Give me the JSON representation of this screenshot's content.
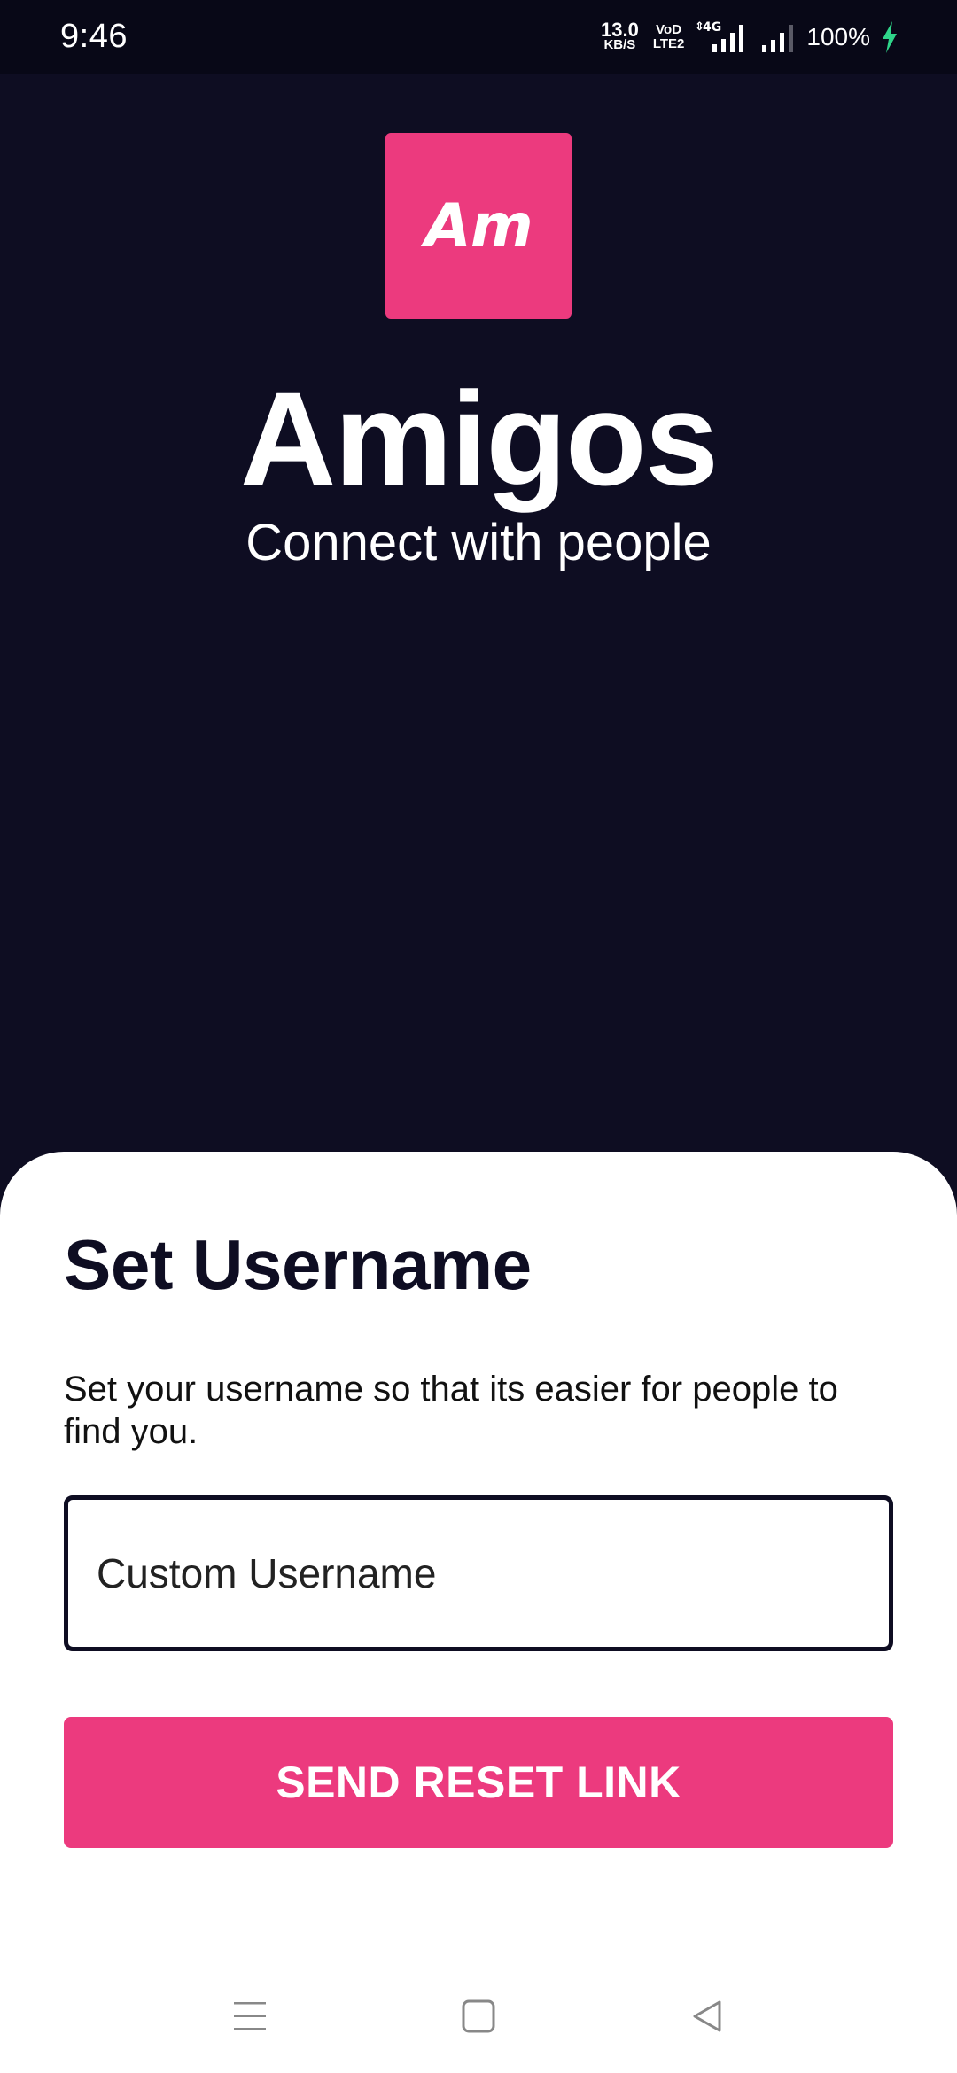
{
  "status_bar": {
    "time": "9:46",
    "net_speed_value": "13.0",
    "net_speed_unit": "KB/S",
    "volte_top": "VoD",
    "volte_bottom": "LTE2",
    "network_type": "4G",
    "battery": "100%",
    "icons": [
      "signal-4g-icon",
      "signal-icon",
      "charging-bolt-icon"
    ],
    "accent": "#2fd58a"
  },
  "branding": {
    "logo_text": "Am",
    "app_name": "Amigos",
    "tagline": "Connect with people",
    "logo_color": "#ec3a7e",
    "background": "#0e0d22"
  },
  "form": {
    "title": "Set Username",
    "description": "Set your username so that its easier for people to find you.",
    "username_placeholder": "Custom Username",
    "username_value": "",
    "submit_label": "SEND RESET LINK",
    "button_color": "#ec3a7e"
  },
  "nav_bar": {
    "icons": [
      "menu-icon",
      "home-icon",
      "back-icon"
    ]
  }
}
